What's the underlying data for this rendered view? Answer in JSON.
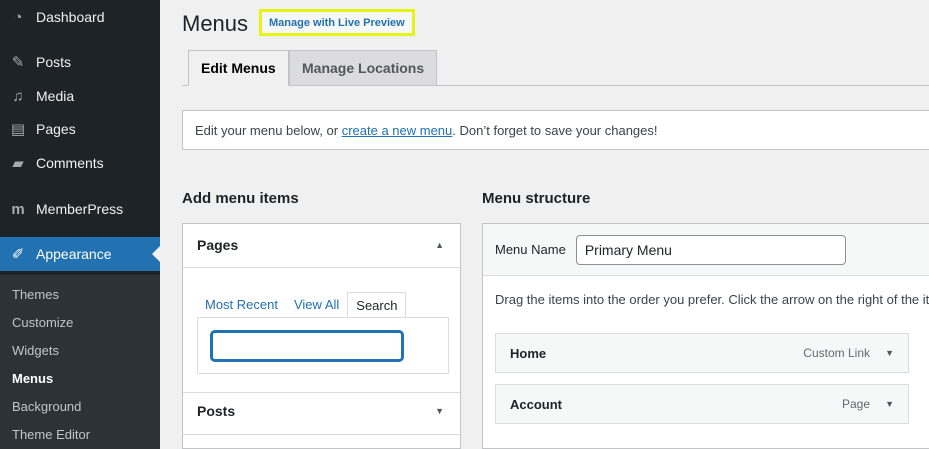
{
  "sidebar": {
    "items": [
      {
        "label": "Dashboard",
        "icon": "dashboard-icon"
      },
      {
        "label": "Posts",
        "icon": "pin-icon"
      },
      {
        "label": "Media",
        "icon": "media-icon"
      },
      {
        "label": "Pages",
        "icon": "pages-icon"
      },
      {
        "label": "Comments",
        "icon": "comment-icon"
      },
      {
        "label": "MemberPress",
        "icon": "memberpress-icon"
      },
      {
        "label": "Appearance",
        "icon": "appearance-icon"
      }
    ],
    "submenu": [
      "Themes",
      "Customize",
      "Widgets",
      "Menus",
      "Background",
      "Theme Editor"
    ],
    "accent_color": "#2271b1"
  },
  "header": {
    "title": "Menus",
    "live_preview_label": "Manage with Live Preview",
    "highlight_color": "#e6f316"
  },
  "tabs": [
    {
      "label": "Edit Menus",
      "active": true
    },
    {
      "label": "Manage Locations",
      "active": false
    }
  ],
  "notice": {
    "before": "Edit your menu below, or ",
    "link": "create a new menu",
    "after": ". Don’t forget to save your changes!"
  },
  "add_items": {
    "heading": "Add menu items",
    "pages_label": "Pages",
    "inner_tabs": [
      "Most Recent",
      "View All",
      "Search"
    ],
    "search_value": "",
    "posts_label": "Posts"
  },
  "structure": {
    "heading": "Menu structure",
    "menu_name_label": "Menu Name",
    "menu_name_value": "Primary Menu",
    "instructions": "Drag the items into the order you prefer. Click the arrow on the right of the ite",
    "items": [
      {
        "title": "Home",
        "type": "Custom Link"
      },
      {
        "title": "Account",
        "type": "Page"
      }
    ]
  }
}
